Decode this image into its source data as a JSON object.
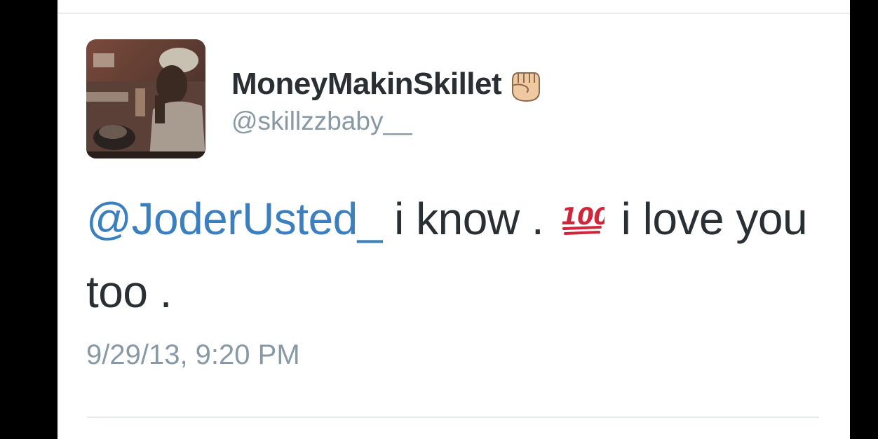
{
  "tweet": {
    "display_name": "MoneyMakinSkillet",
    "handle": "@skillzzbaby__",
    "mention": "@JoderUsted_",
    "text_part1": " i know . ",
    "text_part2": " i love you too .",
    "timestamp": "9/29/13, 9:20 PM",
    "name_emoji_icon": "raised-fist-icon",
    "body_emoji_icon": "hundred-points-icon"
  },
  "colors": {
    "mention": "#3b7fbf",
    "secondary_text": "#8899a6",
    "primary_text": "#292f33",
    "hundred_red": "#d0263a"
  }
}
